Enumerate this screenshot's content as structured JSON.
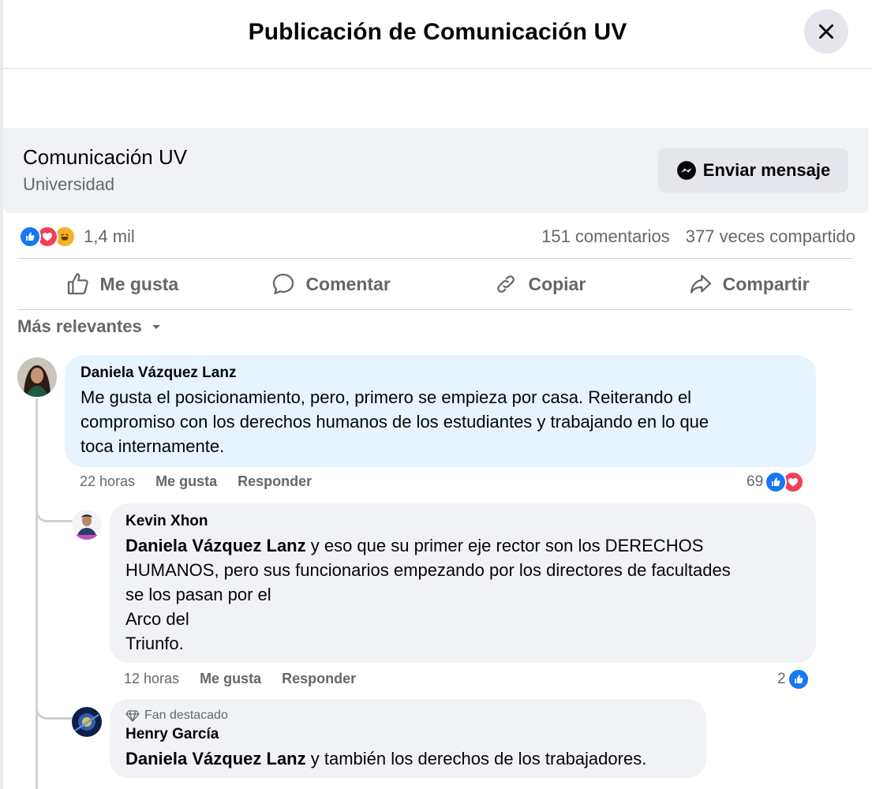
{
  "header": {
    "title": "Publicación de Comunicación UV"
  },
  "page": {
    "name": "Comunicación UV",
    "category": "Universidad",
    "message_button": "Enviar mensaje"
  },
  "stats": {
    "reactions_count": "1,4 mil",
    "comments": "151 comentarios",
    "shares": "377 veces compartido"
  },
  "actions": {
    "like": "Me gusta",
    "comment": "Comentar",
    "copy": "Copiar",
    "share": "Compartir"
  },
  "sort": {
    "label": "Más relevantes"
  },
  "comments": [
    {
      "author": "Daniela Vázquez Lanz",
      "text": "Me gusta el posicionamiento, pero, primero se empieza por casa. Reiterando el\ncompromiso con los derechos humanos de los estudiantes y trabajando en lo que\ntoca internamente.",
      "time": "22 horas",
      "like": "Me gusta",
      "reply": "Responder",
      "reaction_count": "69"
    },
    {
      "author": "Kevin Xhon",
      "mention": "Daniela Vázquez Lanz",
      "text": " y eso que su primer eje rector son los DERECHOS\nHUMANOS, pero sus funcionarios empezando por los directores de facultades\nse los pasan por el\nArco del\nTriunfo.",
      "time": "12 horas",
      "like": "Me gusta",
      "reply": "Responder",
      "reaction_count": "2"
    },
    {
      "badge": "Fan destacado",
      "author": "Henry García",
      "mention": "Daniela Vázquez Lanz",
      "text": " y también los derechos de los trabajadores."
    }
  ],
  "colors": {
    "accent": "#1877f2",
    "love": "#f33e58",
    "haha": "#f7b125",
    "bubble_blue": "#e7f3ff",
    "bubble_gray": "#f0f2f5",
    "secondary_text": "#65676b"
  }
}
